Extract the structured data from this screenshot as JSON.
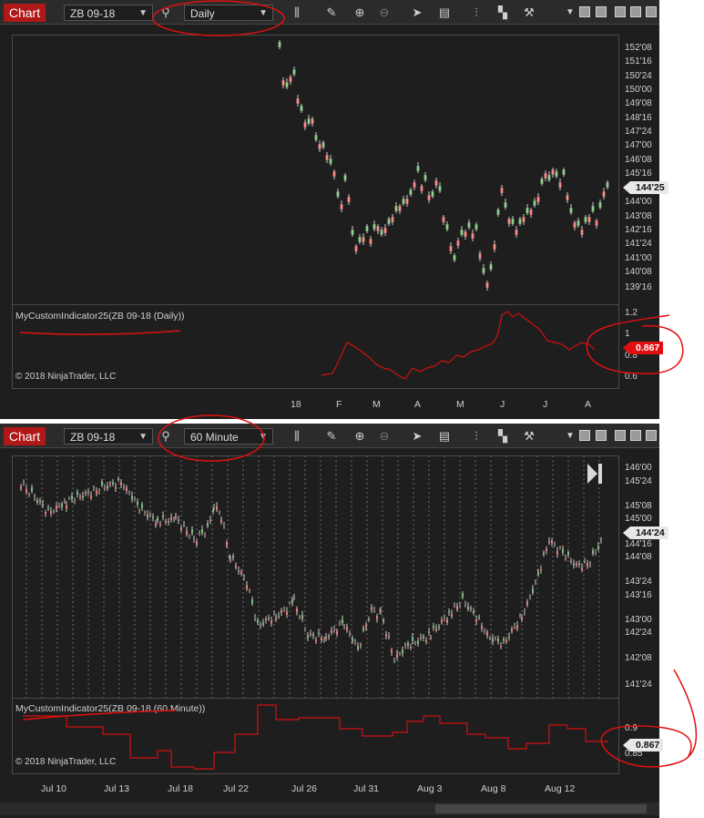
{
  "windows": [
    {
      "tab": "Chart",
      "instrument": "ZB 09-18",
      "interval": "Daily",
      "indicator_label": "MyCustomIndicator25(ZB 09-18 (Daily))",
      "copyright": "© 2018 NinjaTrader, LLC",
      "price_axis": [
        "152'08",
        "151'16",
        "150'24",
        "150'00",
        "149'08",
        "148'16",
        "147'24",
        "147'00",
        "146'08",
        "145'16",
        "144'00",
        "143'08",
        "142'16",
        "141'24",
        "141'00",
        "140'08",
        "139'16"
      ],
      "price_tag": "144'25",
      "indicator_axis": [
        "1.2",
        "1",
        "0.8",
        "0.6"
      ],
      "indicator_tag": "0.867",
      "date_axis": [
        "18",
        "F",
        "M",
        "A",
        "M",
        "J",
        "J",
        "A"
      ]
    },
    {
      "tab": "Chart",
      "instrument": "ZB 09-18",
      "interval": "60 Minute",
      "indicator_label": "MyCustomIndicator25(ZB 09-18 (60 Minute))",
      "copyright": "© 2018 NinjaTrader, LLC",
      "price_axis": [
        "146'00",
        "145'24",
        "145'08",
        "145'00",
        "144'16",
        "144'08",
        "143'24",
        "143'16",
        "143'00",
        "142'24",
        "142'08",
        "141'24"
      ],
      "price_tag": "144'24",
      "indicator_axis": [
        "0.9",
        "0.85"
      ],
      "indicator_tag": "0.867",
      "date_axis": [
        "Jul 10",
        "Jul 13",
        "Jul 18",
        "Jul 22",
        "Jul 26",
        "Jul 31",
        "Aug 3",
        "Aug 8",
        "Aug 12"
      ]
    }
  ],
  "colors": {
    "up_candle": "#8fd18f",
    "down_candle": "#ff8a8a",
    "indicator_line": "#d01010",
    "annotation": "#e01010",
    "chart_tab": "#b01818"
  },
  "icons": [
    "search-icon",
    "bar-style-icon",
    "pencil-icon",
    "zoom-in-icon",
    "zoom-out-icon",
    "pointer-icon",
    "data-box-icon",
    "indicators-icon",
    "strategies-icon",
    "properties-icon",
    "dropdown-arrow-icon",
    "minimize-icon",
    "maximize-icon",
    "close-icon",
    "play-icon"
  ]
}
